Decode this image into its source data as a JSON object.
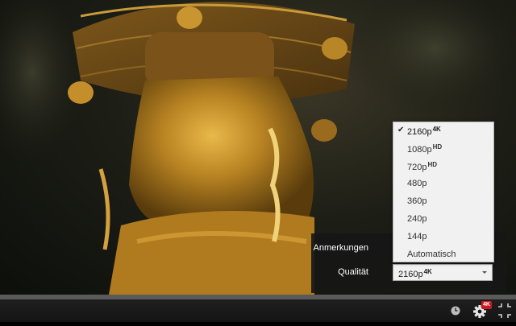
{
  "settings": {
    "annotations_label": "Anmerkungen",
    "quality_label": "Qualität",
    "quality_value": "2160p",
    "quality_badge": "4K"
  },
  "quality_menu": {
    "selected": "2160p",
    "options": [
      {
        "label": "2160p",
        "badge": "4K"
      },
      {
        "label": "1080p",
        "badge": "HD"
      },
      {
        "label": "720p",
        "badge": "HD"
      },
      {
        "label": "480p",
        "badge": ""
      },
      {
        "label": "360p",
        "badge": ""
      },
      {
        "label": "240p",
        "badge": ""
      },
      {
        "label": "144p",
        "badge": ""
      },
      {
        "label": "Automatisch",
        "badge": ""
      }
    ]
  },
  "controls": {
    "settings_badge": "4K",
    "icons": [
      "clock-icon",
      "gear-icon",
      "exit-fullscreen-icon"
    ]
  },
  "colors": {
    "badge_red": "#cc181e",
    "menu_bg": "#f1f1f1",
    "panel_bg": "#161616"
  }
}
